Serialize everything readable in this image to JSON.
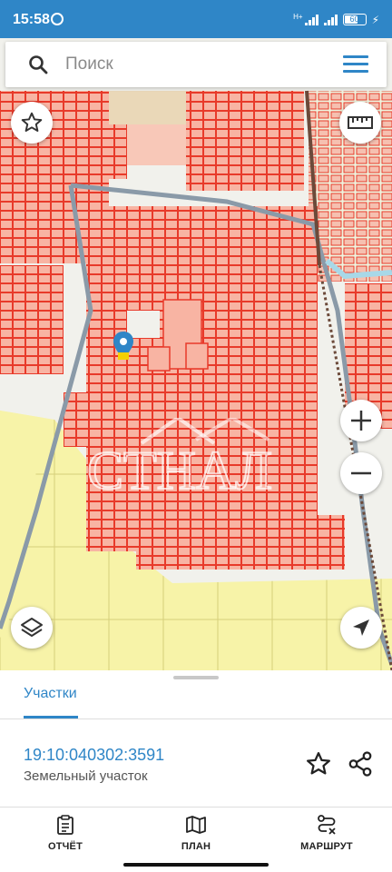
{
  "status_bar": {
    "time": "15:58",
    "battery": "60",
    "network": "H+"
  },
  "search": {
    "placeholder": "Поиск"
  },
  "map": {
    "watermark": "СТНАЛ",
    "controls": [
      "star-icon",
      "ruler-icon",
      "zoom-in-icon",
      "zoom-out-icon",
      "layers-icon",
      "locate-icon"
    ]
  },
  "sheet": {
    "tab_label": "Участки",
    "parcel_number": "19:10:040302:3591",
    "parcel_type": "Земельный участок"
  },
  "bottom_nav": [
    {
      "label": "ОТЧЁТ",
      "icon": "report-icon"
    },
    {
      "label": "ПЛАН",
      "icon": "map-icon"
    },
    {
      "label": "МАРШРУТ",
      "icon": "route-icon"
    }
  ],
  "colors": {
    "accent": "#2f86c7",
    "parcel_fill": "#f8b4a3",
    "parcel_stroke": "#e83a2a",
    "field": "#f7f3a8"
  }
}
